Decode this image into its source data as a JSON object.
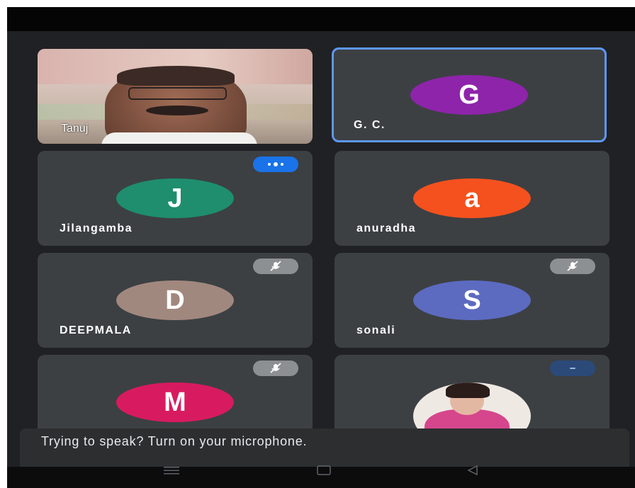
{
  "participants": [
    {
      "name": "Tanuj",
      "type": "video"
    },
    {
      "name": "G. C.",
      "initial": "G",
      "color": "#8e24aa",
      "active_speaker": true
    },
    {
      "name": "Jilangamba",
      "initial": "J",
      "color": "#1e8e6e",
      "indicator": "speaking-icon"
    },
    {
      "name": "anuradha",
      "initial": "a",
      "color": "#f4511e"
    },
    {
      "name": "DEEPMALA",
      "initial": "D",
      "color": "#a1887f",
      "indicator": "mic-off-icon"
    },
    {
      "name": "sonali",
      "initial": "S",
      "color": "#5c6bc0",
      "indicator": "mic-off-icon"
    },
    {
      "name": "",
      "initial": "M",
      "color": "#d81b60",
      "indicator": "mic-off-icon"
    },
    {
      "name": "",
      "type": "photo",
      "indicator": "minus-icon"
    }
  ],
  "toast": {
    "message": "Trying to speak? Turn on your microphone."
  },
  "navigation": {
    "buttons": [
      "menu-icon",
      "home-icon",
      "back-icon"
    ]
  }
}
